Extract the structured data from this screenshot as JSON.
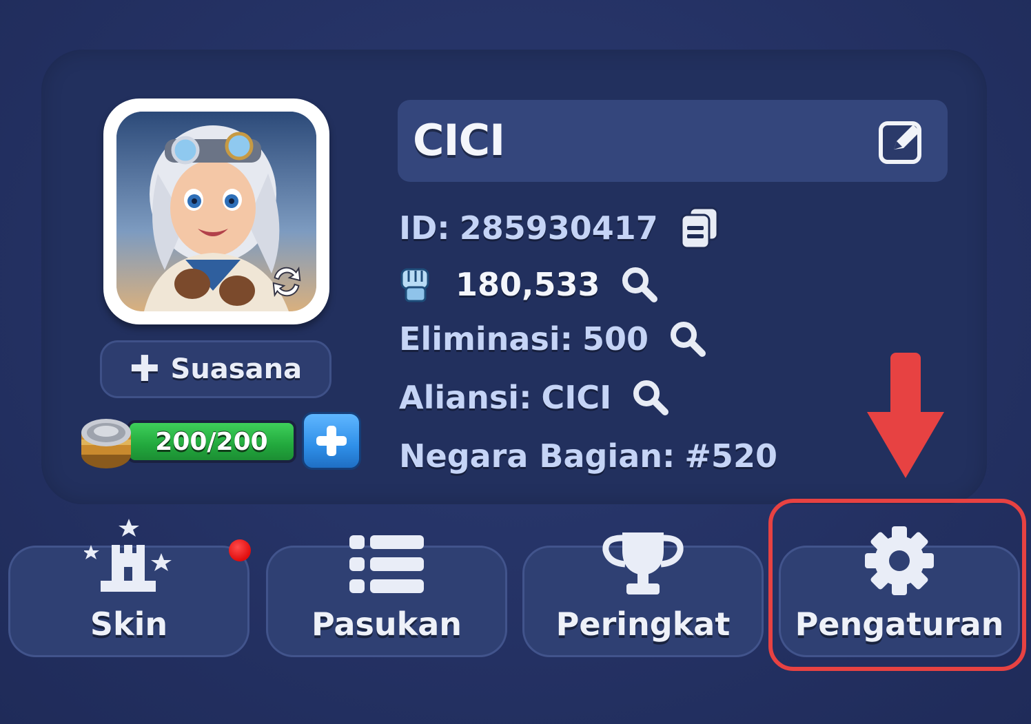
{
  "profile": {
    "player_name": "CICI",
    "id_label": "ID:",
    "id_value": "285930417",
    "power_value": "180,533",
    "elimination_label": "Eliminasi:",
    "elimination_value": "500",
    "alliance_label": "Aliansi:",
    "alliance_value": "CICI",
    "state_label": "Negara Bagian:",
    "state_value": "#520"
  },
  "ambience_button": {
    "label": "Suasana"
  },
  "stamina": {
    "text": "200/200",
    "current": 200,
    "max": 200
  },
  "nav": {
    "skin_label": "Skin",
    "troops_label": "Pasukan",
    "ranking_label": "Peringkat",
    "settings_label": "Pengaturan"
  },
  "colors": {
    "background": "#253466",
    "panel": "#22305e",
    "text_info": "#c5d4f6",
    "highlight_red": "#e74242",
    "stamina_green": "#22a83d",
    "add_blue": "#2f8fe8"
  },
  "icons": [
    "edit-icon",
    "copy-icon",
    "power-fist-icon",
    "search-icon",
    "castle-icon",
    "list-icon",
    "trophy-icon",
    "gear-icon",
    "stamina-can-icon",
    "plus-icon",
    "swap-icon",
    "down-arrow-icon"
  ]
}
